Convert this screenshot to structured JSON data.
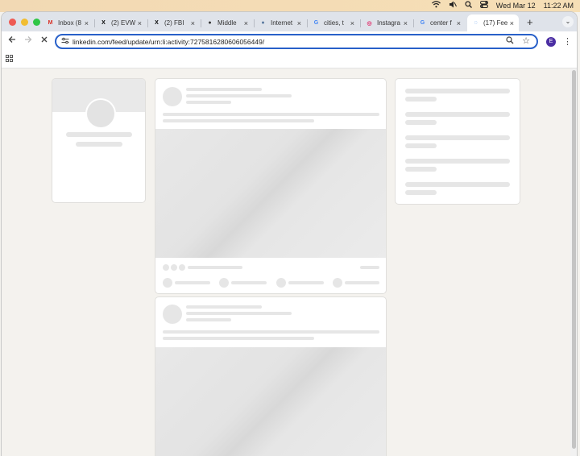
{
  "menubar": {
    "date": "Wed Mar 12",
    "time": "11:22 AM"
  },
  "tabs": [
    {
      "title": "Inbox (8",
      "favicon": "gmail-icon",
      "color": "#d93025",
      "glyph": "M"
    },
    {
      "title": "(2) EVW",
      "favicon": "x-icon",
      "color": "#000000",
      "glyph": "X"
    },
    {
      "title": "(2) FBI",
      "favicon": "x-icon",
      "color": "#000000",
      "glyph": "X"
    },
    {
      "title": "Middle",
      "favicon": "circle-icon",
      "color": "#333333",
      "glyph": "●"
    },
    {
      "title": "Internet",
      "favicon": "globe-icon",
      "color": "#5a7aa0",
      "glyph": "●"
    },
    {
      "title": "cities, t",
      "favicon": "google-icon",
      "color": "#4285f4",
      "glyph": "G"
    },
    {
      "title": "Instagra",
      "favicon": "instagram-icon",
      "color": "#e1306c",
      "glyph": "◎"
    },
    {
      "title": "center f",
      "favicon": "google-icon",
      "color": "#4285f4",
      "glyph": "G"
    },
    {
      "title": "(17) Fee",
      "favicon": "loading-icon",
      "color": "#1a73e8",
      "glyph": "◌"
    }
  ],
  "toolbar": {
    "url": "linkedin.com/feed/update/urn:li:activity:7275816280606056449/",
    "profile_initial": "E"
  },
  "colors": {
    "accent": "#2860c9",
    "profile": "#4b2ea3"
  }
}
